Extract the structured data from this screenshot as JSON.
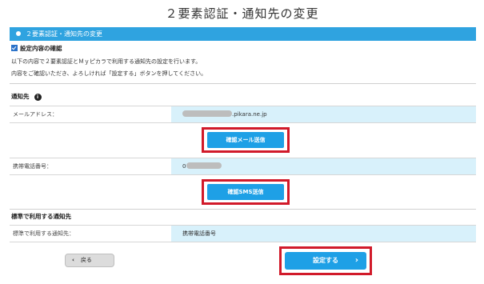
{
  "page": {
    "title": "２要素認証・通知先の変更"
  },
  "banner": {
    "text": "２要素認証・通知先の変更"
  },
  "confirm_section": {
    "heading": "設定内容の確認",
    "desc_line1": "以下の内容で２要素認証とＭｙピカラで利用する通知先の設定を行います。",
    "desc_line2": "内容をご確認いただき、よろしければ「設定する」ボタンを押してください。"
  },
  "notify_section": {
    "heading": "通知先",
    "info_icon": "i",
    "email_label": "メールアドレス：",
    "email_value": ".pikara.ne.jp",
    "email_button": "確認メール送信",
    "phone_label": "携帯電話番号：",
    "phone_value": "0",
    "sms_button": "確認SMS送信"
  },
  "default_section": {
    "heading": "標準で利用する通知先",
    "label": "標準で利用する通知先：",
    "value": "携帯電話番号"
  },
  "actions": {
    "back_label": "戻る",
    "back_icon": "chevron-left-icon",
    "submit_label": "設定する",
    "submit_icon": "chevron-right-icon"
  },
  "colors": {
    "accent_blue": "#1ea0e6",
    "banner_blue": "#2fa3e0",
    "value_bg": "#d8f1fb",
    "highlight_red": "#d11a2a"
  }
}
